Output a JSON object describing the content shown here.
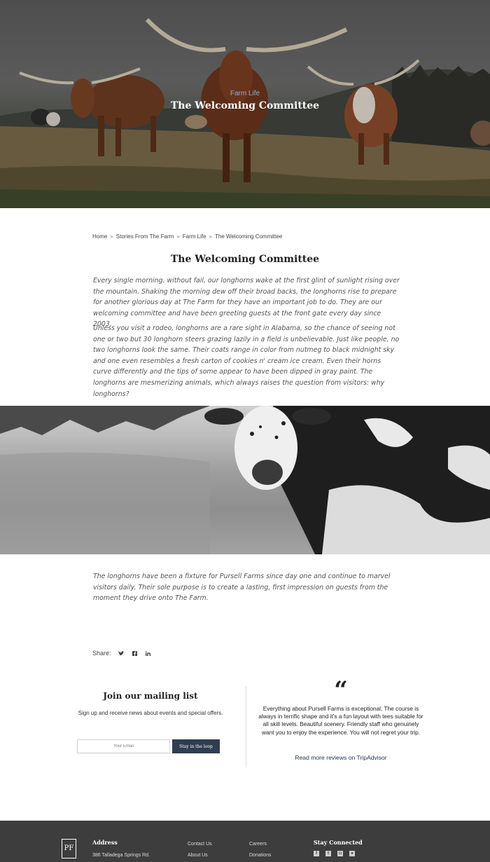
{
  "hero": {
    "kicker": "Farm Life",
    "title": "The Welcoming Committee"
  },
  "breadcrumb": {
    "items": [
      "Home",
      "Stories From The Farm",
      "Farm Life",
      "The Welcoming Committee"
    ],
    "separator": "»"
  },
  "article": {
    "title": "The Welcoming Committee",
    "paragraphs": [
      "Every single morning, without fail, our longhorns wake at the first glint of sunlight rising over the mountain. Shaking the morning dew off their broad backs, the longhorns rise to prepare for another glorious day at The Farm for they have an important job to do. They are our welcoming committee and have been greeting guests at the front gate every day since 2003.",
      "Unless you visit a rodeo, longhorns are a rare sight in Alabama, so the chance of seeing not one or two but 30 longhorn steers grazing lazily in a field is unbelievable. Just like people, no two longhorns look the same. Their coats range in color from nutmeg to black midnight sky and one even resembles a fresh carton of cookies n' cream ice cream. Even their horns curve differently and the tips of some appear to have been dipped in gray paint. The longhorns are mesmerizing animals, which always raises the question from visitors: why longhorns?",
      "The longhorns have been a fixture for Pursell Farms since day one and continue to marvel visitors daily. Their sole purpose is to create a lasting, first impression on guests from the moment they drive onto The Farm."
    ]
  },
  "share": {
    "label": "Share:",
    "icons": [
      "twitter-icon",
      "facebook-icon",
      "linkedin-icon"
    ]
  },
  "mailing": {
    "title": "Join our mailing list",
    "subtitle": "Sign up and receive news about events and special offers.",
    "placeholder": "Your Email",
    "button": "Stay in the loop"
  },
  "review": {
    "quote_mark": "“",
    "text": "Everything about Pursell Farms is exceptional. The course is always in terrific shape and it's a fun layout with tees suitable for all skill levels. Beautiful scenery. Friendly staff who genuinely want you to enjoy the experience. You will not regret your trip.",
    "link": "Read more reviews on TripAdvisor"
  },
  "footer": {
    "logo": "PF",
    "address_heading": "Address",
    "address_line": "386 Talladega Springs Rd.",
    "links_col1": [
      "Contact Us",
      "About Us"
    ],
    "links_col2": [
      "Careers",
      "Donations"
    ],
    "connected_heading": "Stay Connected",
    "social": [
      "facebook-icon",
      "twitter-icon",
      "instagram-icon",
      "flickr-icon"
    ]
  },
  "colors": {
    "accent": "#2f3d4f",
    "kicker": "#8fb2d8",
    "footer_bg": "#3d3d3d"
  }
}
